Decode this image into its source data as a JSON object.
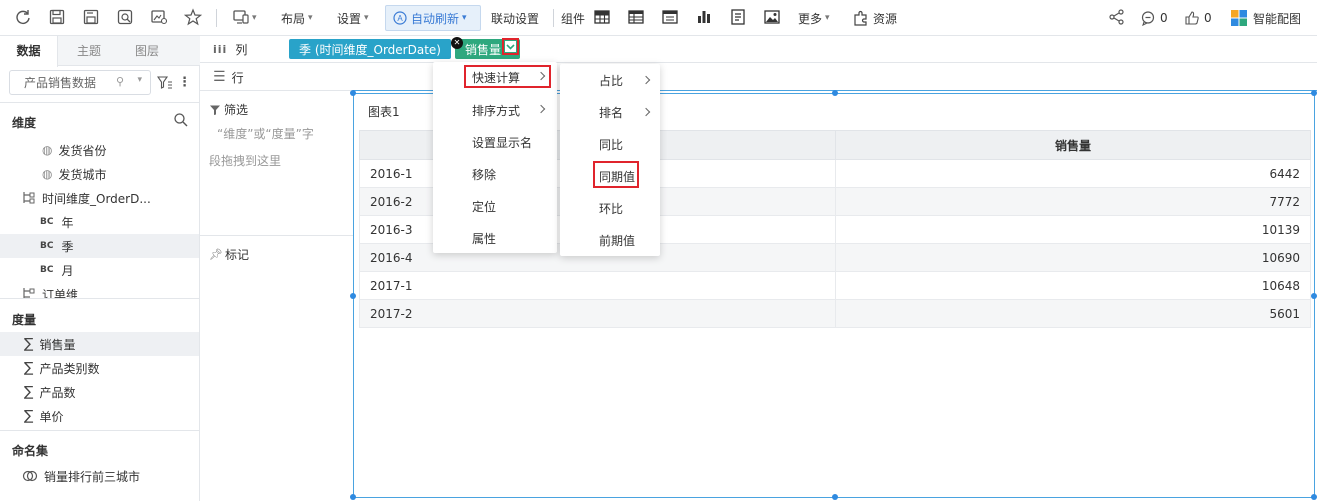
{
  "toolbar": {
    "layout_label": "布局",
    "settings_label": "设置",
    "auto_refresh_label": "自动刷新",
    "linkage_label": "联动设置",
    "component_label": "组件",
    "more_label": "更多",
    "resource_label": "资源",
    "comment_count": "0",
    "like_count": "0",
    "smart_chart_label": "智能配图"
  },
  "left_panel": {
    "tabs": [
      {
        "label": "数据",
        "active": true
      },
      {
        "label": "主题",
        "active": false
      },
      {
        "label": "图层",
        "active": false
      }
    ],
    "dataset": "产品销售数据",
    "dimension_header": "维度",
    "dimensions": [
      {
        "label": "发货省份",
        "icon": "globe-icon"
      },
      {
        "label": "发货城市",
        "icon": "globe-icon"
      },
      {
        "label": "时间维度_OrderD...",
        "icon": "hierarchy-icon"
      },
      {
        "label": "年",
        "icon": "calendar-icon"
      },
      {
        "label": "季",
        "icon": "calendar-icon",
        "selected": true
      },
      {
        "label": "月",
        "icon": "calendar-icon"
      },
      {
        "label": "订单维",
        "icon": "hierarchy-icon"
      }
    ],
    "measure_header": "度量",
    "measures": [
      {
        "label": "销售量",
        "selected": true
      },
      {
        "label": "产品类别数"
      },
      {
        "label": "产品数"
      },
      {
        "label": "单价"
      }
    ],
    "namedset_header": "命名集",
    "namedsets": [
      {
        "label": "销量排行前三城市"
      }
    ]
  },
  "config": {
    "column_label": "列",
    "row_label": "行",
    "filter_label": "筛选",
    "filter_hint_line1": "“维度”或“度量”字",
    "filter_hint_line2": "段拖拽到这里",
    "mark_label": "标记",
    "column_pills": [
      {
        "label": "季 (时间维度_OrderDate)",
        "color": "#29a3c9"
      },
      {
        "label": "销售量",
        "color": "#2ea87e"
      }
    ]
  },
  "chart": {
    "title": "图表1",
    "columns": [
      "",
      "销售量"
    ],
    "rows": [
      {
        "period": "2016-1",
        "value": "6442"
      },
      {
        "period": "2016-2",
        "value": "7772"
      },
      {
        "period": "2016-3",
        "value": "10139"
      },
      {
        "period": "2016-4",
        "value": "10690"
      },
      {
        "period": "2017-1",
        "value": "10648"
      },
      {
        "period": "2017-2",
        "value": "5601"
      }
    ]
  },
  "context_menu": {
    "items": [
      "快速计算",
      "排序方式",
      "设置显示名",
      "移除",
      "定位",
      "属性"
    ],
    "submenu": [
      "占比",
      "排名",
      "同比",
      "同期值",
      "环比",
      "前期值"
    ]
  },
  "colors": {
    "accent": "#2f8ae0",
    "highlight": "#e0242c",
    "dimension_pill": "#29a3c9",
    "measure_pill": "#2ea87e"
  }
}
